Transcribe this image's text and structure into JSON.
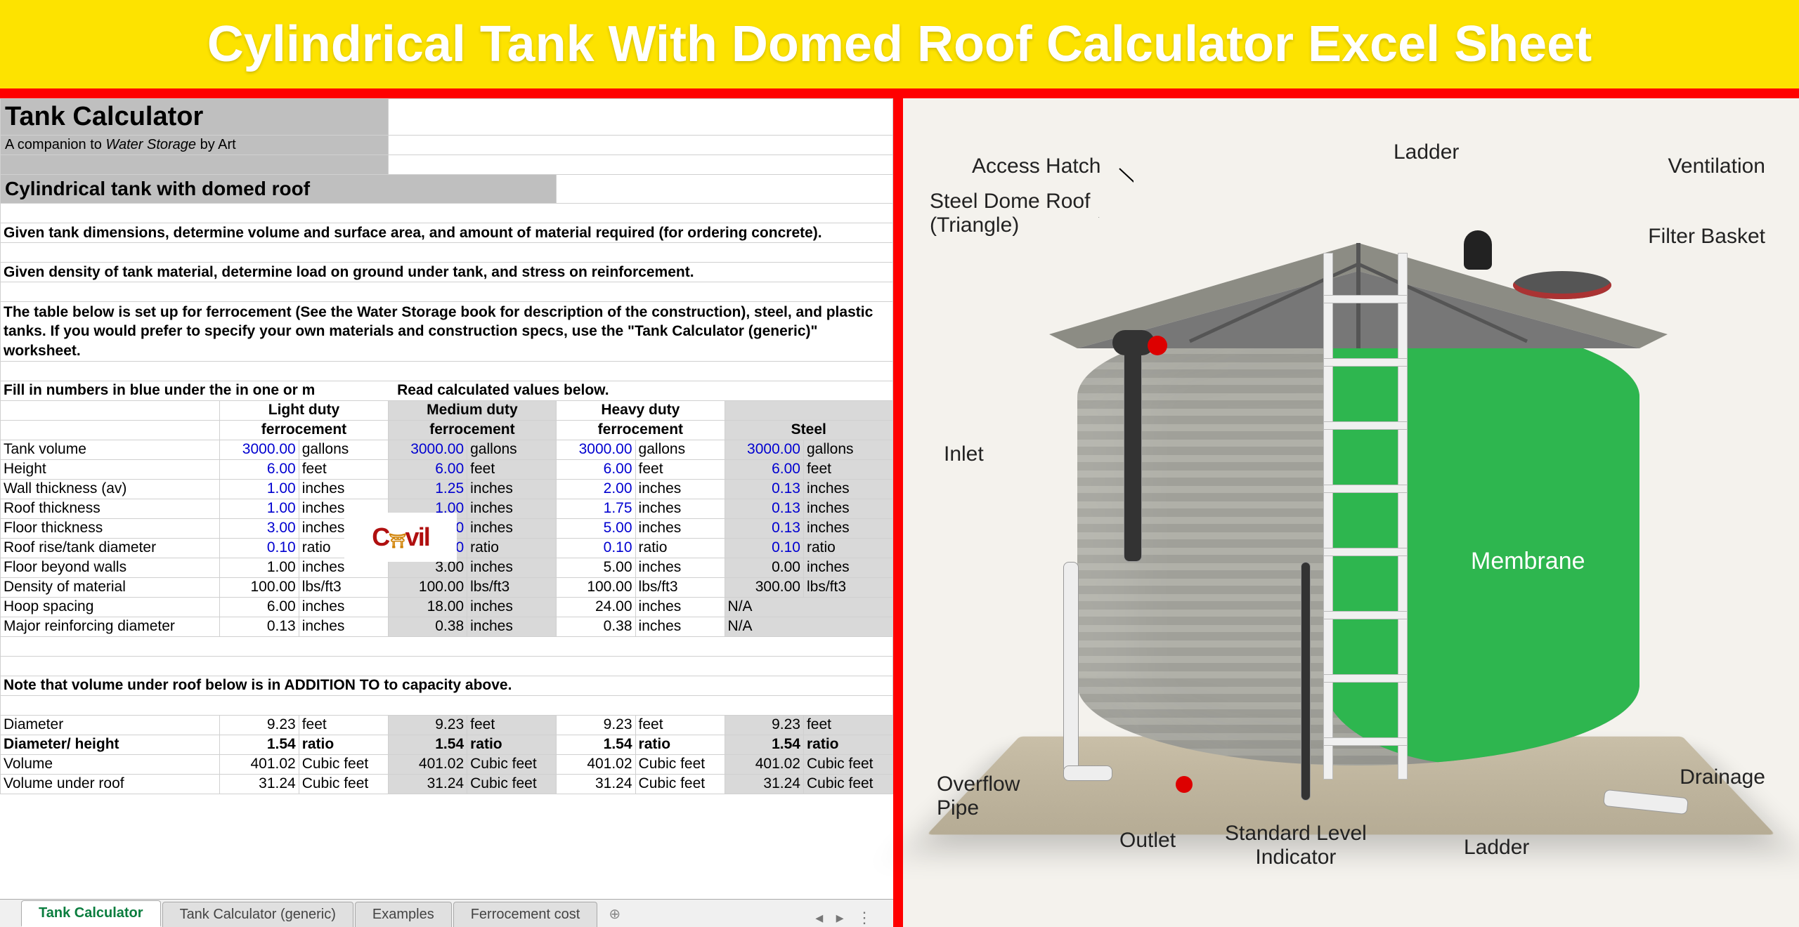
{
  "banner": "Cylindrical Tank With Domed Roof Calculator Excel Sheet",
  "sheet": {
    "title": "Tank Calculator",
    "subtitle_pre": "A companion to ",
    "subtitle_it": "Water Storage",
    "subtitle_post": " by Art",
    "section": "Cylindrical tank with domed roof",
    "desc1": "Given tank dimensions, determine volume and surface area, and amount of material required (for ordering concrete).",
    "desc2": "Given density of tank material, determine load on ground under tank, and stress on reinforcement.",
    "desc3": "The table below is set up for ferrocement (See the Water Storage book for description of the construction), steel, and plastic tanks.  If you would prefer to specify your own materials and construction specs, use the \"Tank Calculator (generic)\" worksheet.",
    "fillnote_a": "Fill in numbers in blue under the in one or m",
    "fillnote_b": "Read calculated values below.",
    "cols": [
      "Light duty ferrocement",
      "Medium duty ferrocement",
      "Heavy duty ferrocement",
      "Steel"
    ],
    "cols_l1": [
      "Light duty",
      "Medium duty",
      "Heavy duty",
      ""
    ],
    "cols_l2": [
      "ferrocement",
      "ferrocement",
      "ferrocement",
      "Steel"
    ],
    "rows": [
      {
        "label": "Tank volume",
        "bold": false,
        "vals": [
          "3000.00",
          "3000.00",
          "3000.00",
          "3000.00"
        ],
        "unit": "gallons",
        "blue": true
      },
      {
        "label": "Height",
        "bold": false,
        "vals": [
          "6.00",
          "6.00",
          "6.00",
          "6.00"
        ],
        "unit": "feet",
        "blue": true
      },
      {
        "label": "Wall thickness (av)",
        "bold": false,
        "vals": [
          "1.00",
          "1.25",
          "2.00",
          "0.13"
        ],
        "unit": "inches",
        "blue": true
      },
      {
        "label": "Roof thickness",
        "bold": false,
        "vals": [
          "1.00",
          "1.00",
          "1.75",
          "0.13"
        ],
        "unit": "inches",
        "blue": true
      },
      {
        "label": "Floor thickness",
        "bold": false,
        "vals": [
          "3.00",
          "4.00",
          "5.00",
          "0.13"
        ],
        "unit": "inches",
        "blue": true
      },
      {
        "label": "Roof rise/tank diameter",
        "bold": false,
        "vals": [
          "0.10",
          "0.10",
          "0.10",
          "0.10"
        ],
        "unit": "ratio",
        "blue": true
      },
      {
        "label": "Floor beyond walls",
        "bold": false,
        "vals": [
          "1.00",
          "3.00",
          "5.00",
          "0.00"
        ],
        "unit": "inches",
        "blue": false
      },
      {
        "label": "Density of material",
        "bold": false,
        "vals": [
          "100.00",
          "100.00",
          "100.00",
          "300.00"
        ],
        "unit": "lbs/ft3",
        "blue": false
      },
      {
        "label": "Hoop spacing",
        "bold": false,
        "vals": [
          "6.00",
          "18.00",
          "24.00",
          "N/A"
        ],
        "unit": "inches",
        "blue": false,
        "na4": true
      },
      {
        "label": "Major reinforcing diameter",
        "bold": false,
        "vals": [
          "0.13",
          "0.38",
          "0.38",
          "N/A"
        ],
        "unit": "inches",
        "blue": false,
        "na4": true
      }
    ],
    "note": "Note that volume under roof below is in ADDITION TO to capacity above.",
    "rows2": [
      {
        "label": "Diameter",
        "bold": false,
        "vals": [
          "9.23",
          "9.23",
          "9.23",
          "9.23"
        ],
        "unit": "feet"
      },
      {
        "label": "Diameter/ height",
        "bold": true,
        "vals": [
          "1.54",
          "1.54",
          "1.54",
          "1.54"
        ],
        "unit": "ratio"
      },
      {
        "label": "Volume",
        "bold": false,
        "vals": [
          "401.02",
          "401.02",
          "401.02",
          "401.02"
        ],
        "unit": "Cubic feet"
      },
      {
        "label": "Volume under roof",
        "bold": false,
        "vals": [
          "31.24",
          "31.24",
          "31.24",
          "31.24"
        ],
        "unit": "Cubic feet"
      }
    ],
    "tabs": [
      "Tank Calculator",
      "Tank Calculator (generic)",
      "Examples",
      "Ferrocement cost"
    ]
  },
  "diagram": {
    "labels": {
      "access_hatch": "Access Hatch",
      "steel_dome": "Steel Dome Roof\n(Triangle)",
      "ladder": "Ladder",
      "ventilation": "Ventilation",
      "filter_basket": "Filter Basket",
      "inlet": "Inlet",
      "membrane": "Membrane",
      "overflow": "Overflow\nPipe",
      "outlet": "Outlet",
      "sli": "Standard Level\nIndicator",
      "ladder2": "Ladder",
      "drainage": "Drainage"
    }
  }
}
